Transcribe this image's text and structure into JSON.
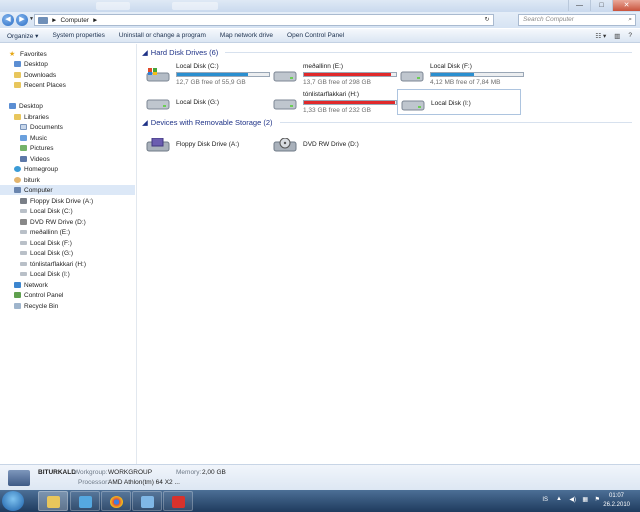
{
  "window": {
    "minimize_glyph": "—",
    "maximize_glyph": "□",
    "close_glyph": "✕"
  },
  "address": {
    "path": "Computer",
    "arrow": "►",
    "refresh_glyph": "↻",
    "search_placeholder": "Search Computer"
  },
  "toolbar": {
    "organize": "Organize ▾",
    "system_properties": "System properties",
    "uninstall": "Uninstall or change a program",
    "map_network_drive": "Map network drive",
    "open_control_panel": "Open Control Panel"
  },
  "nav": {
    "favorites": "Favorites",
    "desktop_fav": "Desktop",
    "downloads": "Downloads",
    "recent_places": "Recent Places",
    "desktop": "Desktop",
    "libraries": "Libraries",
    "documents": "Documents",
    "music": "Music",
    "pictures": "Pictures",
    "videos": "Videos",
    "homegroup": "Homegroup",
    "user": "biturk",
    "computer": "Computer",
    "floppy": "Floppy Disk Drive (A:)",
    "disk_c": "Local Disk (C:)",
    "dvd": "DVD RW Drive (D:)",
    "disk_e": "meðallinn (E:)",
    "disk_f": "Local Disk (F:)",
    "disk_g": "Local Disk (G:)",
    "disk_h": "tónlistarflakkari (H:)",
    "disk_i": "Local Disk (I:)",
    "network": "Network",
    "control_panel": "Control Panel",
    "recycle_bin": "Recycle Bin"
  },
  "groups": {
    "hard_disks": "Hard Disk Drives (6)",
    "removable": "Devices with Removable Storage (2)"
  },
  "drives": {
    "c": {
      "name": "Local Disk (C:)",
      "free": "12,7 GB free of 55,9 GB",
      "used_fraction": 0.77,
      "bar_color": "#2a8fd0"
    },
    "e": {
      "name": "meðallinn (E:)",
      "free": "13,7 GB free of 298 GB",
      "used_fraction": 0.95,
      "bar_color": "#e0292b"
    },
    "f": {
      "name": "Local Disk (F:)",
      "free": "4,12 MB free of 7,84 MB",
      "used_fraction": 0.47,
      "bar_color": "#2a8fd0"
    },
    "g": {
      "name": "Local Disk (G:)"
    },
    "h": {
      "name": "tónlistarflakkari (H:)",
      "free": "1,33 GB free of 232 GB",
      "used_fraction": 0.99,
      "bar_color": "#e0292b"
    },
    "i": {
      "name": "Local Disk (I:)"
    },
    "a": {
      "name": "Floppy Disk Drive (A:)"
    },
    "d": {
      "name": "DVD RW Drive (D:)"
    }
  },
  "details": {
    "pc_name": "BITURKALD",
    "workgroup_label": "Workgroup:",
    "workgroup": "WORKGROUP",
    "memory_label": "Memory:",
    "memory": "2,00 GB",
    "processor_label": "Processor:",
    "processor": "AMD Athlon(tm) 64 X2 ..."
  },
  "tray": {
    "lang": "IS",
    "time": "01:07",
    "date": "26.2.2010"
  }
}
